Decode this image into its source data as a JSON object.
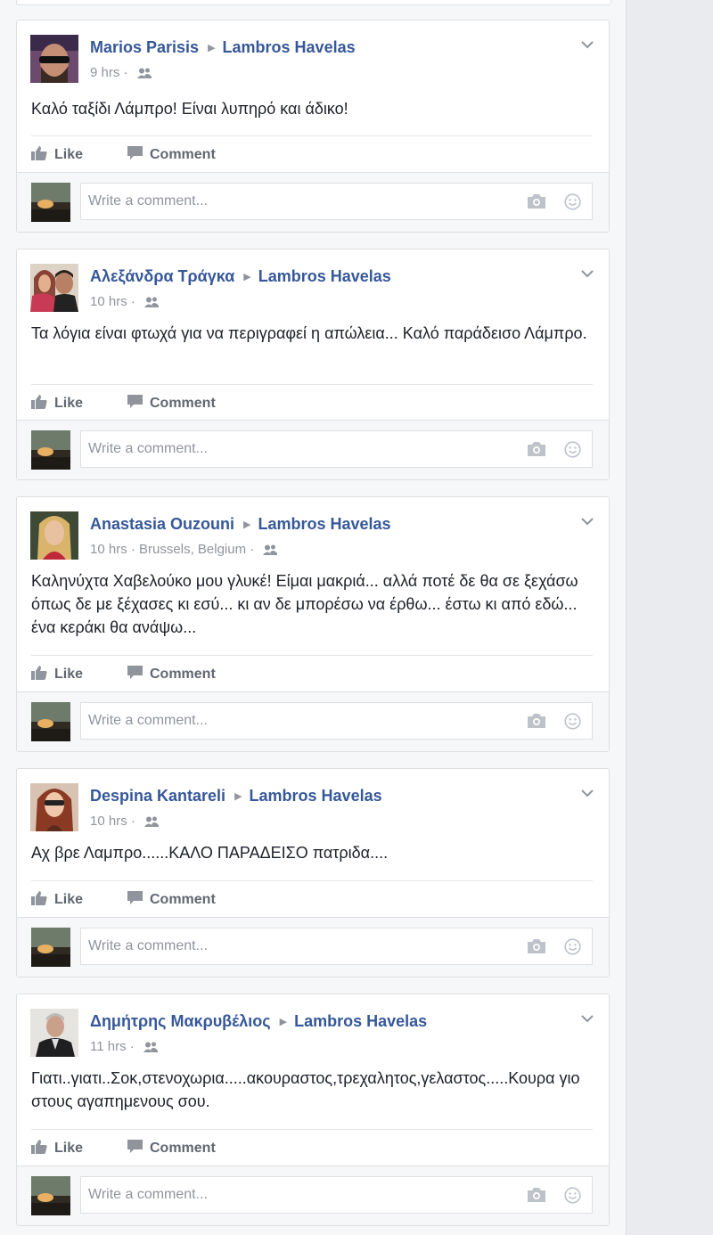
{
  "colors": {
    "link": "#365899",
    "meta": "#90949c",
    "text": "#1d2129",
    "action": "#616770"
  },
  "comment_placeholder": "Write a comment...",
  "actions": {
    "like": "Like",
    "comment": "Comment"
  },
  "posts": [
    {
      "author": "Marios Parisis",
      "target": "Lambros Havelas",
      "time": "9 hrs",
      "location": "",
      "text": "Καλό ταξίδι Λάμπρο! Είναι λυπηρό και άδικο!"
    },
    {
      "author": "Αλεξάνδρα Τράγκα",
      "target": "Lambros Havelas",
      "time": "10 hrs",
      "location": "",
      "text": "Τα λόγια είναι φτωχά για να περιγραφεί η απώλεια... Καλό παράδεισο Λάμπρο."
    },
    {
      "author": "Anastasia Ouzouni",
      "target": "Lambros Havelas",
      "time": "10 hrs",
      "location": "Brussels, Belgium",
      "text": "Καληνύχτα Χαβελούκο μου γλυκέ! Είμαι μακριά... αλλά ποτέ δε θα σε ξεχάσω όπως δε με ξέχασες κι εσύ... κι αν δε μπορέσω να έρθω... έστω κι από εδώ... ένα κεράκι θα ανάψω..."
    },
    {
      "author": "Despina Kantareli",
      "target": "Lambros Havelas",
      "time": "10 hrs",
      "location": "",
      "text": "Αχ βρε Λαμπρο......ΚΑΛΟ ΠΑΡΑΔΕΙΣΟ πατριδα...."
    },
    {
      "author": "Δημήτρης Μακρυβέλιος",
      "target": "Lambros Havelas",
      "time": "11 hrs",
      "location": "",
      "text": "Γιατι..γιατι..Σοκ,στενοχωρια.....ακουραστος,τρεχαλητος,γελαστος.....Κουρα γιο στους αγαπημενους σου."
    }
  ]
}
